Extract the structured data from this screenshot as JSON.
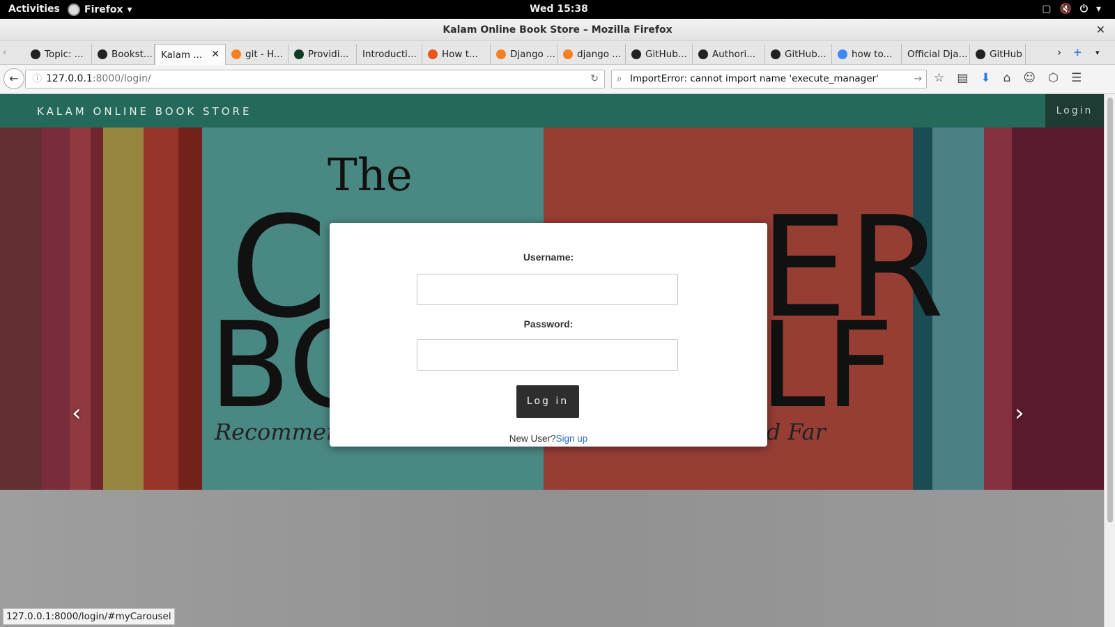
{
  "system": {
    "activities": "Activities",
    "app_name": "Firefox",
    "clock": "Wed 15:38"
  },
  "window": {
    "title": "Kalam Online Book Store – Mozilla Firefox"
  },
  "tabs": [
    {
      "label": "Topic: ...",
      "icon": "github-icon",
      "color": "#222"
    },
    {
      "label": "Bookst...",
      "icon": "github-icon",
      "color": "#222"
    },
    {
      "label": "Kalam ...",
      "icon": "none",
      "color": "#fff",
      "active": true
    },
    {
      "label": "git - H...",
      "icon": "stackoverflow-icon",
      "color": "#f48024"
    },
    {
      "label": "Providi...",
      "icon": "django-icon",
      "color": "#0c3c26"
    },
    {
      "label": "Introducti...",
      "icon": "none",
      "color": "#fff"
    },
    {
      "label": "How t...",
      "icon": "askubuntu-icon",
      "color": "#e95420"
    },
    {
      "label": "Django ...",
      "icon": "stackoverflow-icon",
      "color": "#f48024"
    },
    {
      "label": "django ...",
      "icon": "stackoverflow-icon",
      "color": "#f48024"
    },
    {
      "label": "GitHub...",
      "icon": "github-icon",
      "color": "#222"
    },
    {
      "label": "Authori...",
      "icon": "github-icon",
      "color": "#222"
    },
    {
      "label": "GitHub...",
      "icon": "github-icon",
      "color": "#222"
    },
    {
      "label": "how to...",
      "icon": "google-icon",
      "color": "#4285f4"
    },
    {
      "label": "Official Dja...",
      "icon": "none",
      "color": "#fff"
    },
    {
      "label": "GitHub",
      "icon": "github-icon",
      "color": "#222"
    }
  ],
  "navbar": {
    "url_host": "127.0.0.1",
    "url_path": ":8000/login/",
    "search_value": "ImportError: cannot import name 'execute_manager'"
  },
  "site": {
    "brand": "KALAM ONLINE BOOK STORE",
    "login_link": "Login"
  },
  "carousel_image": {
    "title_word": "The",
    "line1_left": "C",
    "line1_right": "ER",
    "line2_left": "BO",
    "line2_right": "LF",
    "caption_left": "Recommendations From",
    "caption_right": "Shoppers Near and Far"
  },
  "login_form": {
    "username_label": "Username:",
    "password_label": "Password:",
    "submit_label": "Log in",
    "new_user_text": "New User?",
    "signup_link": "Sign up"
  },
  "status": {
    "link_preview": "127.0.0.1:8000/login/#myCarousel"
  }
}
